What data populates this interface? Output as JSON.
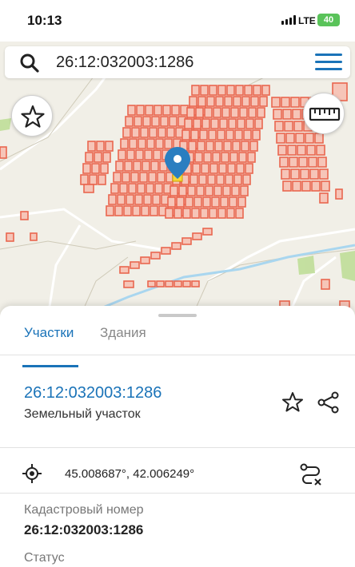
{
  "status_bar": {
    "time": "10:13",
    "network": "LTE",
    "battery": "40"
  },
  "search": {
    "query": "26:12:032003:1286"
  },
  "map": {
    "parcel_color": "#e9664f",
    "parcel_fill": "#f6c5b8",
    "road_color": "#ffffff",
    "river_color": "#a9d6ef",
    "green_color": "#b9dc8f",
    "marker_color": "#2a7ec0",
    "highlight_color": "#f5d73a"
  },
  "panel": {
    "tabs": [
      {
        "label": "Участки",
        "active": true
      },
      {
        "label": "Здания",
        "active": false
      }
    ],
    "parcel": {
      "id": "26:12:032003:1286",
      "type": "Земельный участок"
    },
    "coordinates": "45.008687°, 42.006249°",
    "fields": [
      {
        "label": "Кадастровый номер",
        "value": "26:12:032003:1286"
      },
      {
        "label": "Статус",
        "value": ""
      }
    ]
  }
}
